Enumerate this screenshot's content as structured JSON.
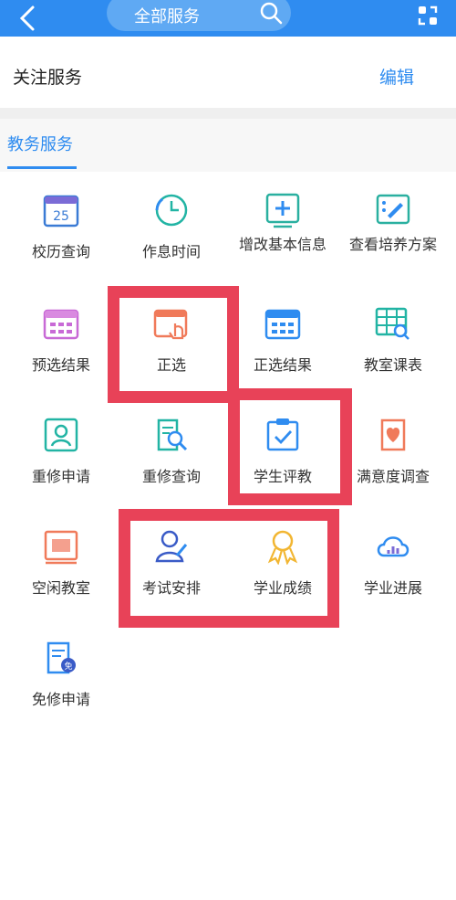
{
  "header": {
    "search_label": "全部服务"
  },
  "follow": {
    "title": "关注服务",
    "edit": "编辑"
  },
  "tab": {
    "label": "教务服务"
  },
  "items": [
    {
      "label": "校历查询",
      "icon": "calendar-25-icon",
      "badge": "25"
    },
    {
      "label": "作息时间",
      "icon": "clock-icon"
    },
    {
      "label": "增改基本信息",
      "icon": "add-info-icon"
    },
    {
      "label": "查看培养方案",
      "icon": "edit-plan-icon"
    },
    {
      "label": "预选结果",
      "icon": "calendar-grid-icon"
    },
    {
      "label": "正选",
      "icon": "calendar-hand-icon"
    },
    {
      "label": "正选结果",
      "icon": "calendar-grid-icon"
    },
    {
      "label": "教室课表",
      "icon": "table-search-icon"
    },
    {
      "label": "重修申请",
      "icon": "user-card-icon"
    },
    {
      "label": "重修查询",
      "icon": "document-search-icon"
    },
    {
      "label": "学生评教",
      "icon": "clipboard-check-icon"
    },
    {
      "label": "满意度调查",
      "icon": "heart-scroll-icon"
    },
    {
      "label": "空闲教室",
      "icon": "window-icon"
    },
    {
      "label": "考试安排",
      "icon": "user-pen-icon"
    },
    {
      "label": "学业成绩",
      "icon": "medal-icon"
    },
    {
      "label": "学业进展",
      "icon": "cloud-chart-icon"
    },
    {
      "label": "免修申请",
      "icon": "document-exempt-icon",
      "badge": "免"
    }
  ]
}
